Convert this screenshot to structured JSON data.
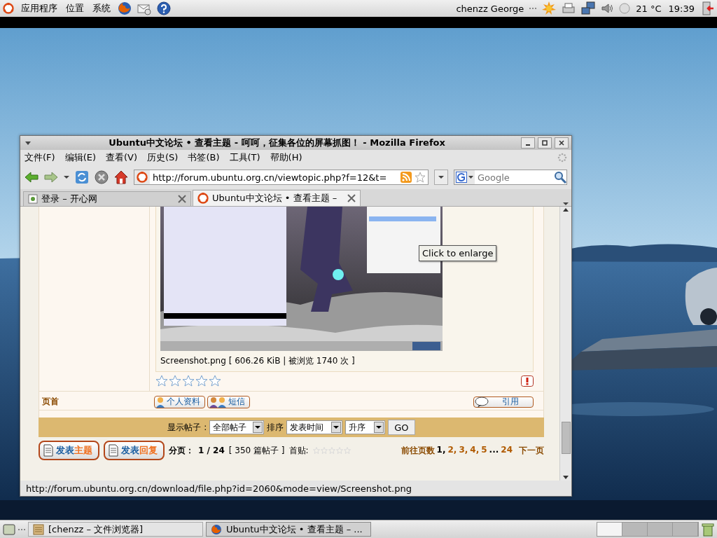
{
  "top_panel": {
    "menus": [
      "应用程序",
      "位置",
      "系统"
    ],
    "user": "chenzz George",
    "temperature": "21 °C",
    "clock": "19:39"
  },
  "window": {
    "title": "Ubuntu中文论坛 • 查看主题 - 呵呵，征集各位的屏幕抓图！ - Mozilla Firefox",
    "menu": [
      "文件(F)",
      "编辑(E)",
      "查看(V)",
      "历史(S)",
      "书签(B)",
      "工具(T)",
      "帮助(H)"
    ],
    "url": "http://forum.ubuntu.org.cn/viewtopic.php?f=12&t=",
    "search": {
      "placeholder": "Google"
    },
    "tabs": [
      {
        "label": "登录 – 开心网",
        "selected": false
      },
      {
        "label": "Ubuntu中文论坛 • 查看主题 –",
        "selected": true
      }
    ],
    "status_bar": "http://forum.ubuntu.org.cn/download/file.php?id=2060&mode=view/Screenshot.png"
  },
  "post": {
    "attachment_caption": "Screenshot.png [ 606.26 KiB | 被浏览 1740 次 ]",
    "stars": 0,
    "tooltip": "Click to enlarge",
    "side_link": "页首",
    "profile_buttons": [
      "个人资料",
      "短信"
    ],
    "quote_button": "引用"
  },
  "filter_bar": {
    "show_label": "显示帖子 :",
    "show_value": "全部帖子",
    "sort_label": "排序",
    "sort_value": "发表时间",
    "order_value": "升序",
    "go": "GO"
  },
  "footer": {
    "post_buttons": [
      {
        "label": "发表",
        "accent": "主题"
      },
      {
        "label": "发表",
        "accent": "回复"
      }
    ],
    "page_label": "分页：",
    "page_info": "1 / 24",
    "post_count": "[ 350 篇帖子 ]",
    "first_post_label": "首贴:",
    "first_post_rating": {
      "stars": 0
    },
    "goto_label": "前往页数",
    "pages": [
      {
        "label": "1,",
        "selected": true
      },
      {
        "label": "2,",
        "selected": false
      },
      {
        "label": "3,",
        "selected": false
      },
      {
        "label": "4,",
        "selected": false
      },
      {
        "label": "5",
        "selected": false
      }
    ],
    "ellipsis": "...",
    "last_page": "24",
    "next": "下一页"
  },
  "taskbar": {
    "items": [
      {
        "label": "[chenzz – 文件浏览器]",
        "selected": false
      },
      {
        "label": "Ubuntu中文论坛 • 查看主题 – ...",
        "selected": true
      }
    ],
    "workspaces": [
      {
        "selected": true
      },
      {
        "selected": false
      },
      {
        "selected": false
      },
      {
        "selected": false
      }
    ]
  }
}
